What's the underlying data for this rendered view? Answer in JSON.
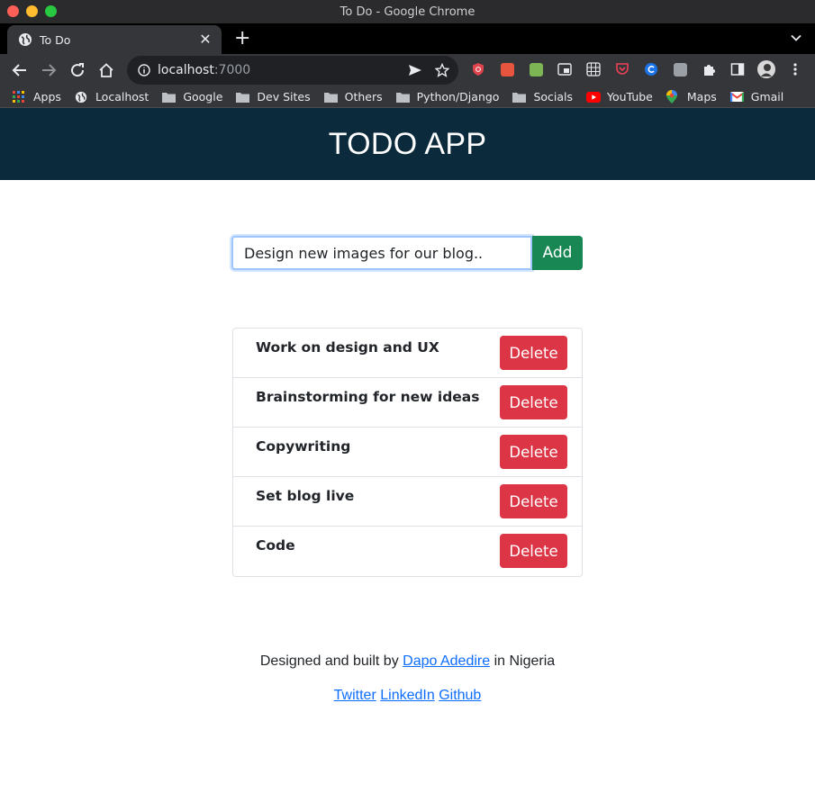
{
  "window": {
    "title": "To Do - Google Chrome"
  },
  "tab": {
    "title": "To Do"
  },
  "omnibox": {
    "host": "localhost",
    "port": ":7000"
  },
  "bookmarks": [
    {
      "label": "Apps",
      "icon": "apps-grid-icon"
    },
    {
      "label": "Localhost",
      "icon": "globe-icon"
    },
    {
      "label": "Google",
      "icon": "folder-icon"
    },
    {
      "label": "Dev Sites",
      "icon": "folder-icon"
    },
    {
      "label": "Others",
      "icon": "folder-icon"
    },
    {
      "label": "Python/Django",
      "icon": "folder-icon"
    },
    {
      "label": "Socials",
      "icon": "folder-icon"
    },
    {
      "label": "YouTube",
      "icon": "youtube-icon"
    },
    {
      "label": "Maps",
      "icon": "maps-pin-icon"
    },
    {
      "label": "Gmail",
      "icon": "gmail-icon"
    }
  ],
  "app": {
    "header": "TODO APP",
    "input_value": "Design new images for our blog..",
    "add_label": "Add",
    "delete_label": "Delete",
    "todos": [
      "Work on design and UX",
      "Brainstorming for new ideas",
      "Copywriting",
      "Set blog live",
      "Code"
    ]
  },
  "footer": {
    "prefix": "Designed and built by",
    "author": "Dapo Adedire",
    "suffix": "in Nigeria",
    "links": [
      "Twitter",
      "LinkedIn",
      "Github"
    ]
  },
  "colors": {
    "header_bg": "#0b2a3b",
    "add_button": "#198754",
    "delete_button": "#dc3545",
    "link": "#0d6efd"
  }
}
